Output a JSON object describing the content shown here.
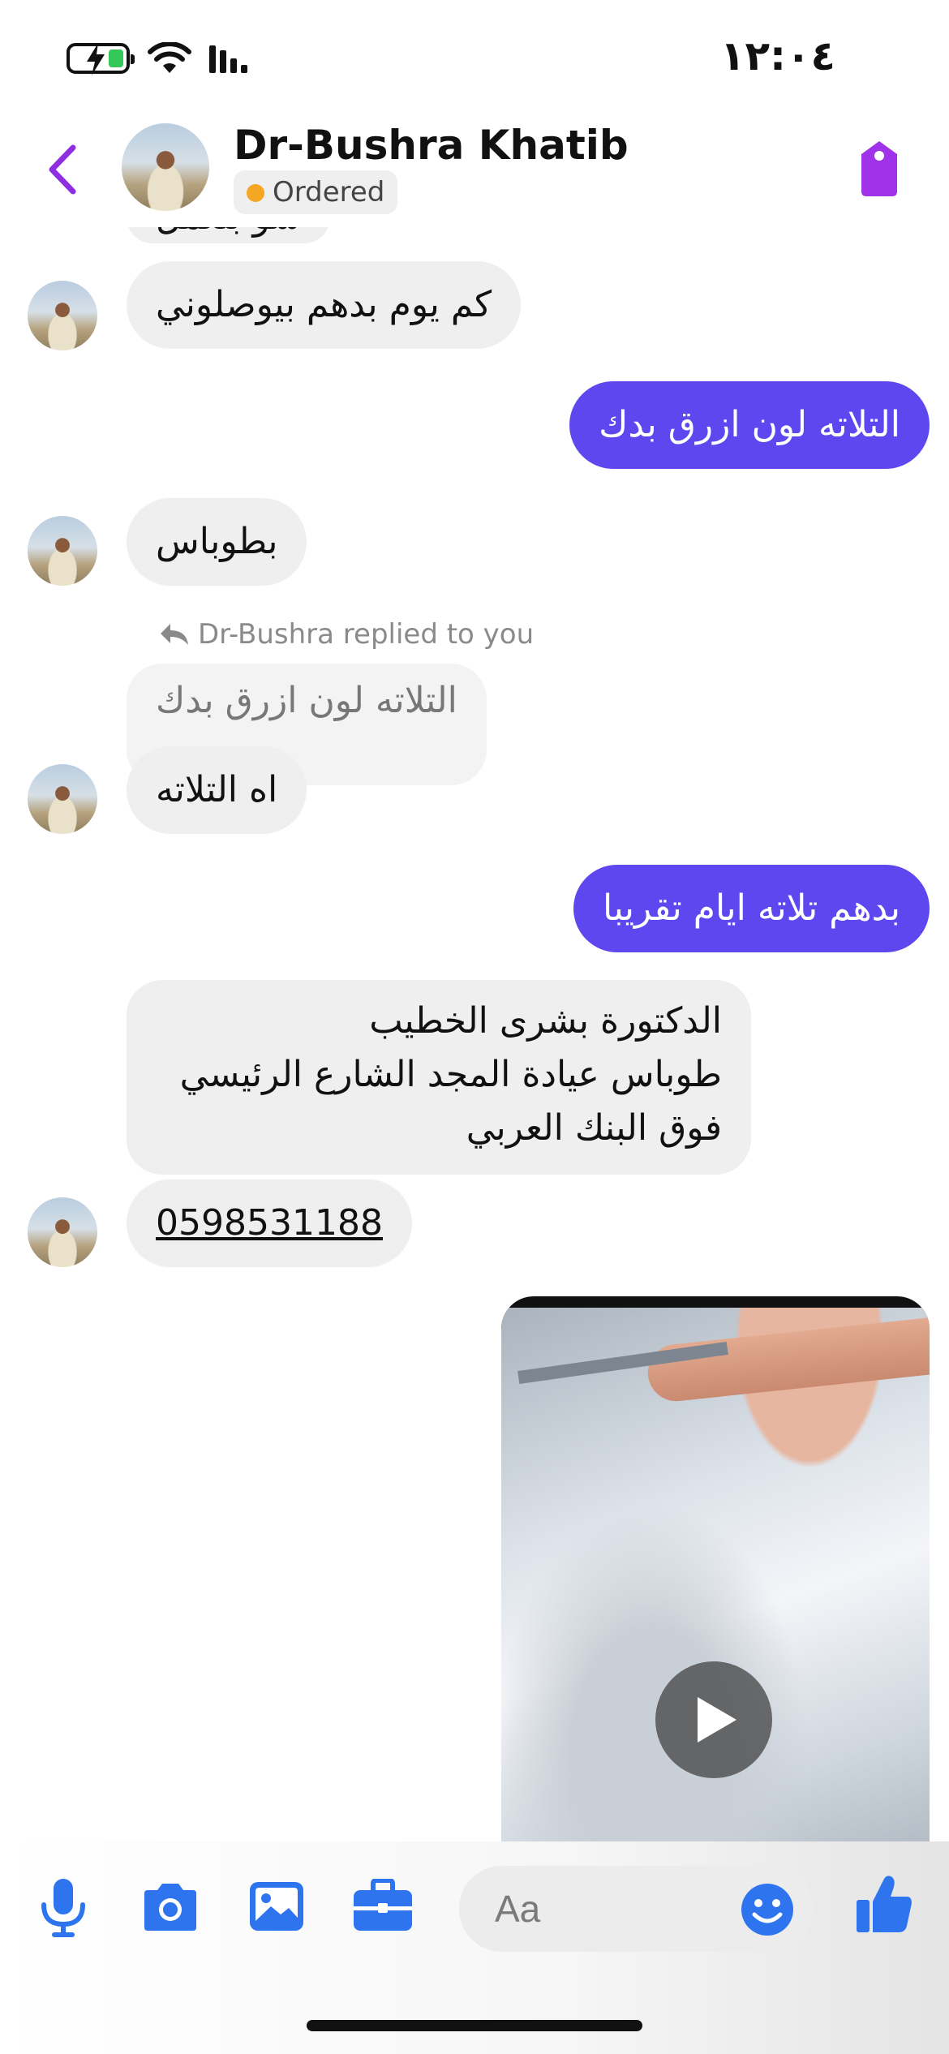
{
  "status_bar": {
    "time": "١٢:٠٤",
    "battery": "charging",
    "icons": [
      "battery-charging-icon",
      "wifi-icon",
      "cellular-signal-icon"
    ]
  },
  "header": {
    "contact_name": "Dr-Bushra Khatib",
    "status_label": "Ordered",
    "status_color": "#f5a623",
    "accent_color": "#8e2de2",
    "icons": [
      "back-chevron-icon",
      "tag-icon"
    ]
  },
  "messages": [
    {
      "side": "in",
      "text": "شو بتعمل",
      "partial": true
    },
    {
      "side": "in",
      "text": "كم يوم بدهم بيوصلوني"
    },
    {
      "side": "out",
      "text": "التلاته لون ازرق بدك"
    },
    {
      "side": "in",
      "text": "بطوباس"
    },
    {
      "side": "in",
      "reply_label": "Dr-Bushra replied to you",
      "quoted_text": "التلاته لون ازرق بدك",
      "text": "اه التلاته"
    },
    {
      "side": "out",
      "text": "بدهم تلاته ايام تقريبا"
    },
    {
      "side": "in",
      "lines": [
        "الدكتورة بشرى الخطيب",
        "طوباس عيادة المجد الشارع الرئيسي",
        "فوق البنك العربي"
      ]
    },
    {
      "side": "in",
      "text": "0598531188",
      "link": true
    },
    {
      "side": "out",
      "type": "video"
    }
  ],
  "colors": {
    "outgoing_bubble": "#5f47f0",
    "incoming_bubble": "#efefef",
    "messenger_blue": "#2f74ef"
  },
  "composer": {
    "placeholder": "Aa",
    "icons": [
      "microphone-icon",
      "camera-icon",
      "gallery-icon",
      "briefcase-icon",
      "emoji-icon",
      "thumbs-up-icon"
    ]
  }
}
